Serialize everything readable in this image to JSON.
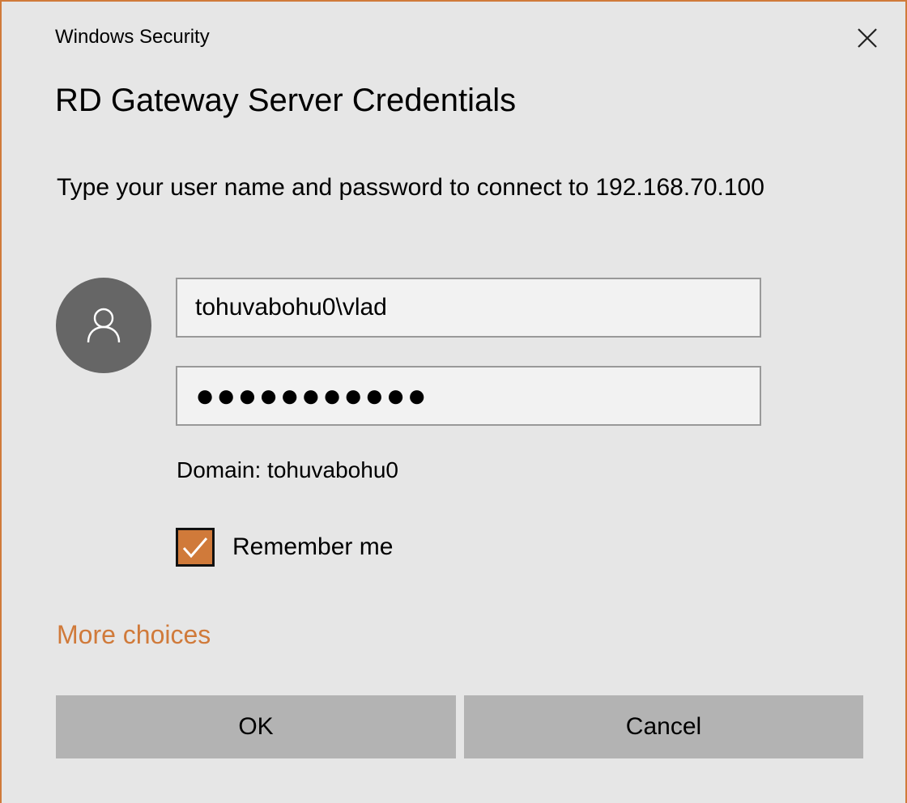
{
  "window": {
    "title": "Windows Security",
    "close_icon": "close-icon"
  },
  "dialog": {
    "heading": "RD Gateway Server Credentials",
    "message": "Type your user name and password to connect to 192.168.70.100"
  },
  "credentials": {
    "avatar_icon": "user-icon",
    "username": "tohuvabohu0\\vlad",
    "password_masked": "●●●●●●●●●●●",
    "domain_label": "Domain: tohuvabohu0"
  },
  "remember": {
    "label": "Remember me",
    "checked": true
  },
  "links": {
    "more_choices": "More choices"
  },
  "buttons": {
    "ok": "OK",
    "cancel": "Cancel"
  },
  "colors": {
    "accent": "#d07a3a",
    "background": "#e6e6e6",
    "button": "#b3b3b3",
    "avatar": "#666666"
  }
}
